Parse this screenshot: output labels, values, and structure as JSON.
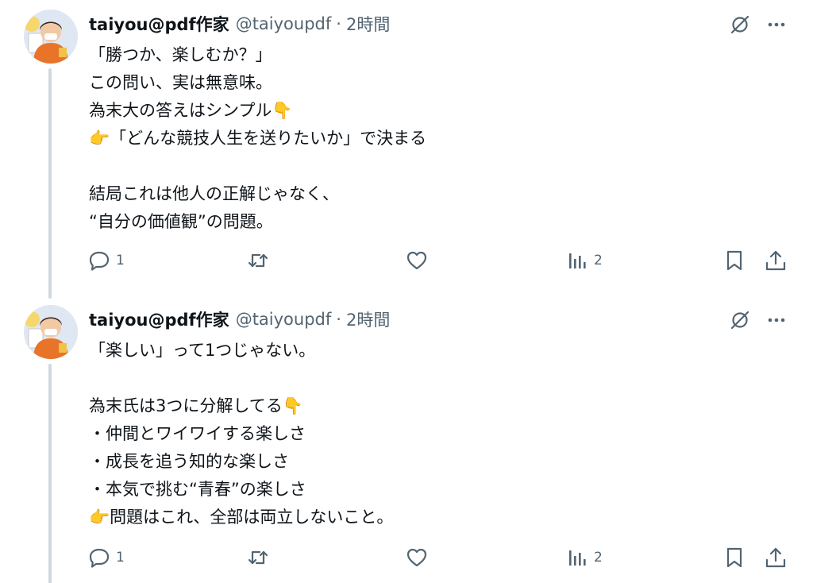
{
  "tweets": [
    {
      "display_name": "taiyou@pdf作家",
      "handle": "@taiyoupdf",
      "separator": "·",
      "time": "2時間",
      "lines": [
        "「勝つか、楽しむか？」",
        "この問い、実は無意味。",
        "為末大の答えはシンプル👇",
        "👉「どんな競技人生を送りたいか」で決まる",
        "",
        "結局これは他人の正解じゃなく、",
        "“自分の価値観”の問題。"
      ],
      "replies": "1",
      "retweets": "",
      "likes": "",
      "views": "2",
      "icons": [
        "avatar",
        "grok-icon",
        "more-icon",
        "reply-icon",
        "retweet-icon",
        "like-icon",
        "views-icon",
        "bookmark-icon",
        "share-icon"
      ]
    },
    {
      "display_name": "taiyou@pdf作家",
      "handle": "@taiyoupdf",
      "separator": "·",
      "time": "2時間",
      "lines": [
        "「楽しい」って1つじゃない。",
        "",
        "為末氏は3つに分解してる👇",
        "・仲間とワイワイする楽しさ",
        "・成長を追う知的な楽しさ",
        "・本気で挑む“青春”の楽しさ",
        "👉問題はこれ、全部は両立しないこと。"
      ],
      "replies": "1",
      "retweets": "",
      "likes": "",
      "views": "2",
      "icons": [
        "avatar",
        "grok-icon",
        "more-icon",
        "reply-icon",
        "retweet-icon",
        "like-icon",
        "views-icon",
        "bookmark-icon",
        "share-icon"
      ]
    }
  ],
  "colors": {
    "text": "#0f1419",
    "secondary": "#536471",
    "thread_line": "#cfd9de",
    "background": "#ffffff"
  }
}
